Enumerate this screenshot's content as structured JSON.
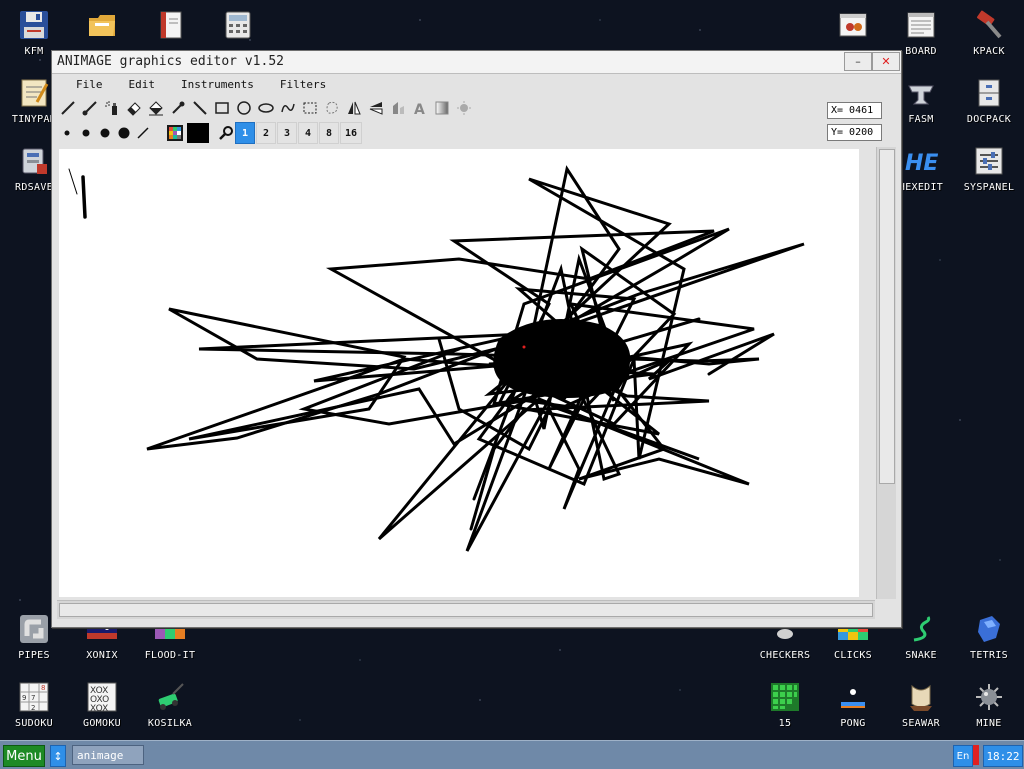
{
  "desktop": {
    "left_icons": [
      {
        "label": "KFM",
        "icon": "floppy-disk-icon"
      },
      {
        "label": "TINYPAD",
        "icon": "notepad-icon"
      },
      {
        "label": "RDSAVE",
        "icon": "ramdisk-save-icon"
      }
    ],
    "top_icons": [
      {
        "label": "",
        "icon": "folder-icon"
      },
      {
        "label": "",
        "icon": "book-icon"
      },
      {
        "label": "",
        "icon": "calculator-icon"
      }
    ],
    "right_icons": [
      {
        "label": "",
        "icon": "bug-window-icon"
      },
      {
        "label": "BOARD",
        "icon": "board-icon"
      },
      {
        "label": "KPACK",
        "icon": "hammer-icon"
      },
      {
        "label": "FASM",
        "icon": "anvil-icon"
      },
      {
        "label": "DOCPACK",
        "icon": "cabinet-icon"
      },
      {
        "label": "HEXEDIT",
        "icon": "hex-icon"
      },
      {
        "label": "SYSPANEL",
        "icon": "sliders-icon"
      }
    ],
    "bottom_icons": [
      {
        "label": "PIPES",
        "icon": "pipes-icon"
      },
      {
        "label": "XONIX",
        "icon": "xonix-icon"
      },
      {
        "label": "FLOOD-IT",
        "icon": "flood-it-icon"
      },
      {
        "label": "CHECKERS",
        "icon": "checkers-icon"
      },
      {
        "label": "CLICKS",
        "icon": "clicks-icon"
      },
      {
        "label": "SNAKE",
        "icon": "snake-icon"
      },
      {
        "label": "TETRIS",
        "icon": "tetris-icon"
      },
      {
        "label": "SUDOKU",
        "icon": "sudoku-icon"
      },
      {
        "label": "GOMOKU",
        "icon": "gomoku-icon"
      },
      {
        "label": "KOSILKA",
        "icon": "lawnmower-icon"
      },
      {
        "label": "15",
        "icon": "fifteen-puzzle-icon"
      },
      {
        "label": "PONG",
        "icon": "pong-icon"
      },
      {
        "label": "SEAWAR",
        "icon": "seawar-icon"
      },
      {
        "label": "MINE",
        "icon": "mine-icon"
      }
    ]
  },
  "window": {
    "title": "ANIMAGE graphics editor v1.52",
    "minimize_glyph": "–",
    "close_glyph": "✕",
    "close_color": "#e02020",
    "menu": [
      "File",
      "Edit",
      "Instruments",
      "Filters"
    ],
    "tools_row1": [
      "pencil-icon",
      "brush-icon",
      "spray-icon",
      "eraser-icon",
      "fill-icon",
      "pipette-icon",
      "line-icon",
      "rectangle-icon",
      "circle-icon",
      "ellipse-icon",
      "curve-icon",
      "selection-icon",
      "lasso-icon",
      "flip-horizontal-icon",
      "flip-vertical-icon",
      "rotate-icon",
      "text-icon",
      "gradient-icon",
      "stamp-icon"
    ],
    "brush_sizes": [
      "small-dot-icon",
      "medium-dot-icon",
      "large-dot-icon",
      "xlarge-dot-icon",
      "diagonal-brush-icon"
    ],
    "palette_icon": "palette-icon",
    "current_color": "#000000",
    "zoom_icon": "zoom-icon",
    "zoom_levels": [
      "1",
      "2",
      "3",
      "4",
      "8",
      "16"
    ],
    "zoom_selected": "1",
    "coord_x": "X= 0461",
    "coord_y": "Y= 0200",
    "accent": "#2f8fe8"
  },
  "taskbar": {
    "menu_label": "Menu",
    "switch_glyph": "↕",
    "task_label": "animage",
    "lang": "En",
    "clock": "18:22",
    "menu_color": "#1d8a25"
  }
}
